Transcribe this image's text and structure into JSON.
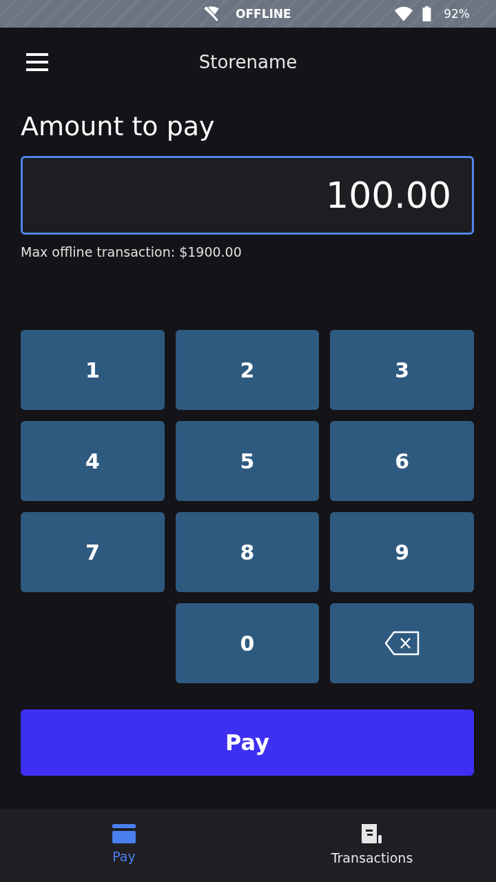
{
  "status_bar": {
    "network": "OFFLINE",
    "battery": "92%"
  },
  "header": {
    "title": "Storename"
  },
  "amount": {
    "label": "Amount to pay",
    "value": "100.00",
    "focused": true,
    "note": "Max offline transaction: $1900.00"
  },
  "keypad": [
    {
      "kind": "digit",
      "label": "1"
    },
    {
      "kind": "digit",
      "label": "2"
    },
    {
      "kind": "digit",
      "label": "3"
    },
    {
      "kind": "digit",
      "label": "4"
    },
    {
      "kind": "digit",
      "label": "5"
    },
    {
      "kind": "digit",
      "label": "6"
    },
    {
      "kind": "digit",
      "label": "7"
    },
    {
      "kind": "digit",
      "label": "8"
    },
    {
      "kind": "digit",
      "label": "9"
    },
    {
      "kind": "blank"
    },
    {
      "kind": "digit",
      "label": "0"
    },
    {
      "kind": "backspace"
    }
  ],
  "pay_button": "Pay",
  "bottom_nav": [
    {
      "label": "Pay",
      "kind": "pay",
      "selected": true
    },
    {
      "label": "Transactions",
      "kind": "transactions",
      "selected": false
    }
  ]
}
